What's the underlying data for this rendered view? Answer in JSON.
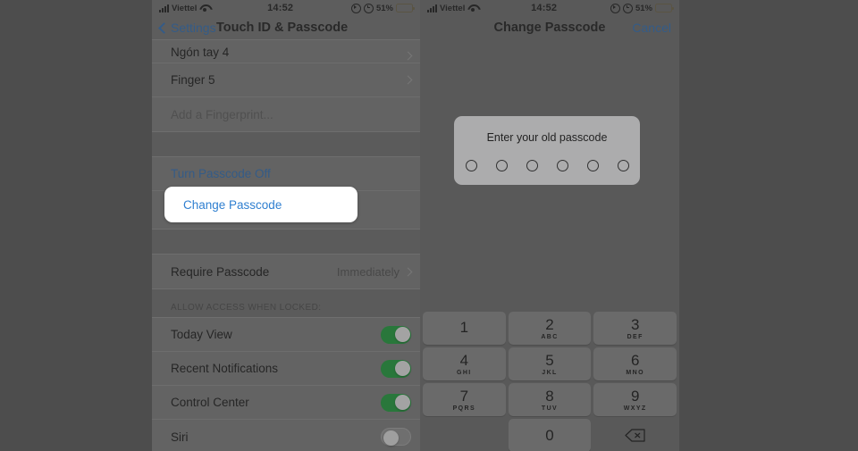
{
  "status_bar": {
    "carrier": "Viettel",
    "time": "14:52",
    "battery_percent": "51%",
    "signal_icon": "signal-bars-icon",
    "wifi_icon": "wifi-icon",
    "location_icon": "location-arrow-icon",
    "alarm_icon": "alarm-clock-icon",
    "battery_icon": "battery-low-power-icon",
    "battery_color": "#e8c44a"
  },
  "settings_screen": {
    "back_label": "Settings",
    "title": "Touch ID & Passcode",
    "fingerprints": [
      {
        "label": "Ngón tay 4",
        "accessory": "chevron-right-icon"
      },
      {
        "label": "Finger 5",
        "accessory": "chevron-right-icon"
      },
      {
        "label": "Add a Fingerprint...",
        "accessory": "none"
      }
    ],
    "passcode_actions": [
      {
        "label": "Turn Passcode Off"
      },
      {
        "label": "Change Passcode"
      }
    ],
    "require_passcode": {
      "label": "Require Passcode",
      "value": "Immediately",
      "accessory": "chevron-right-icon"
    },
    "allow_access_header": "ALLOW ACCESS WHEN LOCKED:",
    "allow_access_items": [
      {
        "label": "Today View",
        "state": "on"
      },
      {
        "label": "Recent Notifications",
        "state": "on"
      },
      {
        "label": "Control Center",
        "state": "on"
      },
      {
        "label": "Siri",
        "state": "off"
      }
    ],
    "highlighted_item": "Change Passcode",
    "accent_color": "#2f7fd0",
    "toggle_on_color": "#1d9c3a"
  },
  "change_passcode_screen": {
    "title": "Change Passcode",
    "cancel_label": "Cancel",
    "prompt": "Enter your old passcode",
    "passcode_length": 6,
    "entered_count": 0,
    "keypad": [
      {
        "num": "1",
        "alpha": ""
      },
      {
        "num": "2",
        "alpha": "ABC"
      },
      {
        "num": "3",
        "alpha": "DEF"
      },
      {
        "num": "4",
        "alpha": "GHI"
      },
      {
        "num": "5",
        "alpha": "JKL"
      },
      {
        "num": "6",
        "alpha": "MNO"
      },
      {
        "num": "7",
        "alpha": "PQRS"
      },
      {
        "num": "8",
        "alpha": "TUV"
      },
      {
        "num": "9",
        "alpha": "WXYZ"
      },
      {
        "num": "0",
        "alpha": ""
      }
    ],
    "delete_icon": "backspace-icon"
  }
}
